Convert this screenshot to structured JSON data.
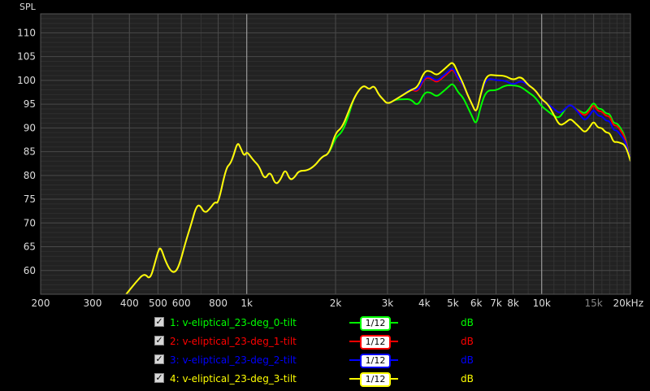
{
  "chart_data": {
    "type": "line",
    "ylabel": "SPL",
    "xscale": "log",
    "xlim": [
      200,
      20000
    ],
    "ylim": [
      55,
      114
    ],
    "xticks": [
      {
        "v": 200,
        "t": "200"
      },
      {
        "v": 300,
        "t": "300"
      },
      {
        "v": 400,
        "t": "400"
      },
      {
        "v": 500,
        "t": "500"
      },
      {
        "v": 600,
        "t": "600"
      },
      {
        "v": 800,
        "t": "800"
      },
      {
        "v": 1000,
        "t": "1k"
      },
      {
        "v": 2000,
        "t": "2k"
      },
      {
        "v": 3000,
        "t": "3k"
      },
      {
        "v": 4000,
        "t": "4k"
      },
      {
        "v": 5000,
        "t": "5k"
      },
      {
        "v": 6000,
        "t": "6k"
      },
      {
        "v": 7000,
        "t": "7k"
      },
      {
        "v": 8000,
        "t": "8k"
      },
      {
        "v": 10000,
        "t": "10k"
      },
      {
        "v": 15000,
        "t": "15k"
      },
      {
        "v": 20000,
        "t": "20kHz"
      }
    ],
    "yticks": [
      60,
      65,
      70,
      75,
      80,
      85,
      90,
      95,
      100,
      105,
      110
    ],
    "base": {
      "f": [
        390,
        420,
        450,
        470,
        490,
        500,
        510,
        530,
        550,
        570,
        590,
        620,
        650,
        670,
        690,
        720,
        750,
        780,
        800,
        850,
        880,
        900,
        930,
        950,
        980,
        1000,
        1030,
        1060,
        1100,
        1150,
        1200,
        1250,
        1300,
        1350,
        1400,
        1450,
        1500,
        1600,
        1700,
        1800,
        1900,
        2000,
        2100,
        2200,
        2300,
        2400,
        2500,
        2600,
        2700,
        2800,
        2900,
        3000,
        3200,
        3400,
        3600,
        3800,
        4000,
        4200,
        4400,
        4600,
        4800,
        5000,
        5200,
        5400,
        5600,
        5800,
        6000,
        6200,
        6500,
        7000,
        7500,
        8000,
        8500,
        9000,
        9500,
        10000,
        10500,
        11000,
        11500,
        12000,
        12500,
        13000,
        13500,
        14000,
        14500,
        15000,
        15500,
        16000,
        16500,
        17000,
        17500,
        18000,
        18500,
        19000,
        19500,
        20000
      ],
      "y": [
        55,
        57.5,
        59.5,
        58,
        62,
        64,
        65,
        62,
        60,
        59.5,
        61,
        66,
        70,
        73,
        74,
        72,
        73,
        74.5,
        74,
        81.5,
        82.5,
        84,
        87,
        86,
        84,
        85,
        84,
        83,
        82,
        79,
        81,
        78,
        79,
        81.5,
        79,
        79.5,
        81,
        81,
        82,
        84,
        84.5,
        89,
        90,
        93,
        96,
        98,
        99,
        98,
        99,
        97,
        96,
        95,
        96,
        97,
        98,
        97,
        100,
        100,
        99,
        100,
        101,
        102,
        100,
        99,
        97,
        95,
        93,
        97,
        100.5,
        100,
        100,
        99,
        100,
        99,
        98,
        96,
        95,
        94,
        93,
        94,
        95,
        94,
        93,
        92,
        93,
        94.5,
        93,
        93,
        92,
        92,
        90,
        90,
        89,
        88,
        86,
        83
      ]
    },
    "series": [
      {
        "name": "1: v-eliptical_23-deg_0-tilt",
        "color": "#00ff00",
        "segments": [
          {
            "from": 1900,
            "to": 2300,
            "d": -1
          },
          {
            "from": 3200,
            "to": 8000,
            "d": -2.5
          },
          {
            "from": 8000,
            "to": 12000,
            "d": -1.5
          },
          {
            "from": 13000,
            "to": 20000,
            "d": 1
          }
        ]
      },
      {
        "name": "2: v-eliptical_23-deg_1-tilt",
        "color": "#ff0000",
        "segments": [
          {
            "from": 3500,
            "to": 5500,
            "d": 0.5
          },
          {
            "from": 13000,
            "to": 20000,
            "d": 0.5
          }
        ]
      },
      {
        "name": "3: v-eliptical_23-deg_2-tilt",
        "color": "#0000ff",
        "segments": [
          {
            "from": 3500,
            "to": 5500,
            "d": 0.8
          },
          {
            "from": 13000,
            "to": 20000,
            "d": -0.5
          }
        ]
      },
      {
        "name": "4: v-eliptical_23-deg_3-tilt",
        "color": "#ffff00",
        "segments": [
          {
            "from": 3600,
            "to": 5500,
            "d": 2
          },
          {
            "from": 6200,
            "to": 9000,
            "d": 1
          },
          {
            "from": 10500,
            "to": 20000,
            "d": -3
          }
        ]
      }
    ]
  },
  "legend": [
    {
      "checked": "✓",
      "label": "1: v-eliptical_23-deg_0-tilt",
      "smoothing": "1/12",
      "unit": "dB",
      "color": "#00ff00"
    },
    {
      "checked": "✓",
      "label": "2: v-eliptical_23-deg_1-tilt",
      "smoothing": "1/12",
      "unit": "dB",
      "color": "#ff0000"
    },
    {
      "checked": "✓",
      "label": "3: v-eliptical_23-deg_2-tilt",
      "smoothing": "1/12",
      "unit": "dB",
      "color": "#0000ff"
    },
    {
      "checked": "✓",
      "label": "4: v-eliptical_23-deg_3-tilt",
      "smoothing": "1/12",
      "unit": "dB",
      "color": "#ffff00"
    }
  ]
}
